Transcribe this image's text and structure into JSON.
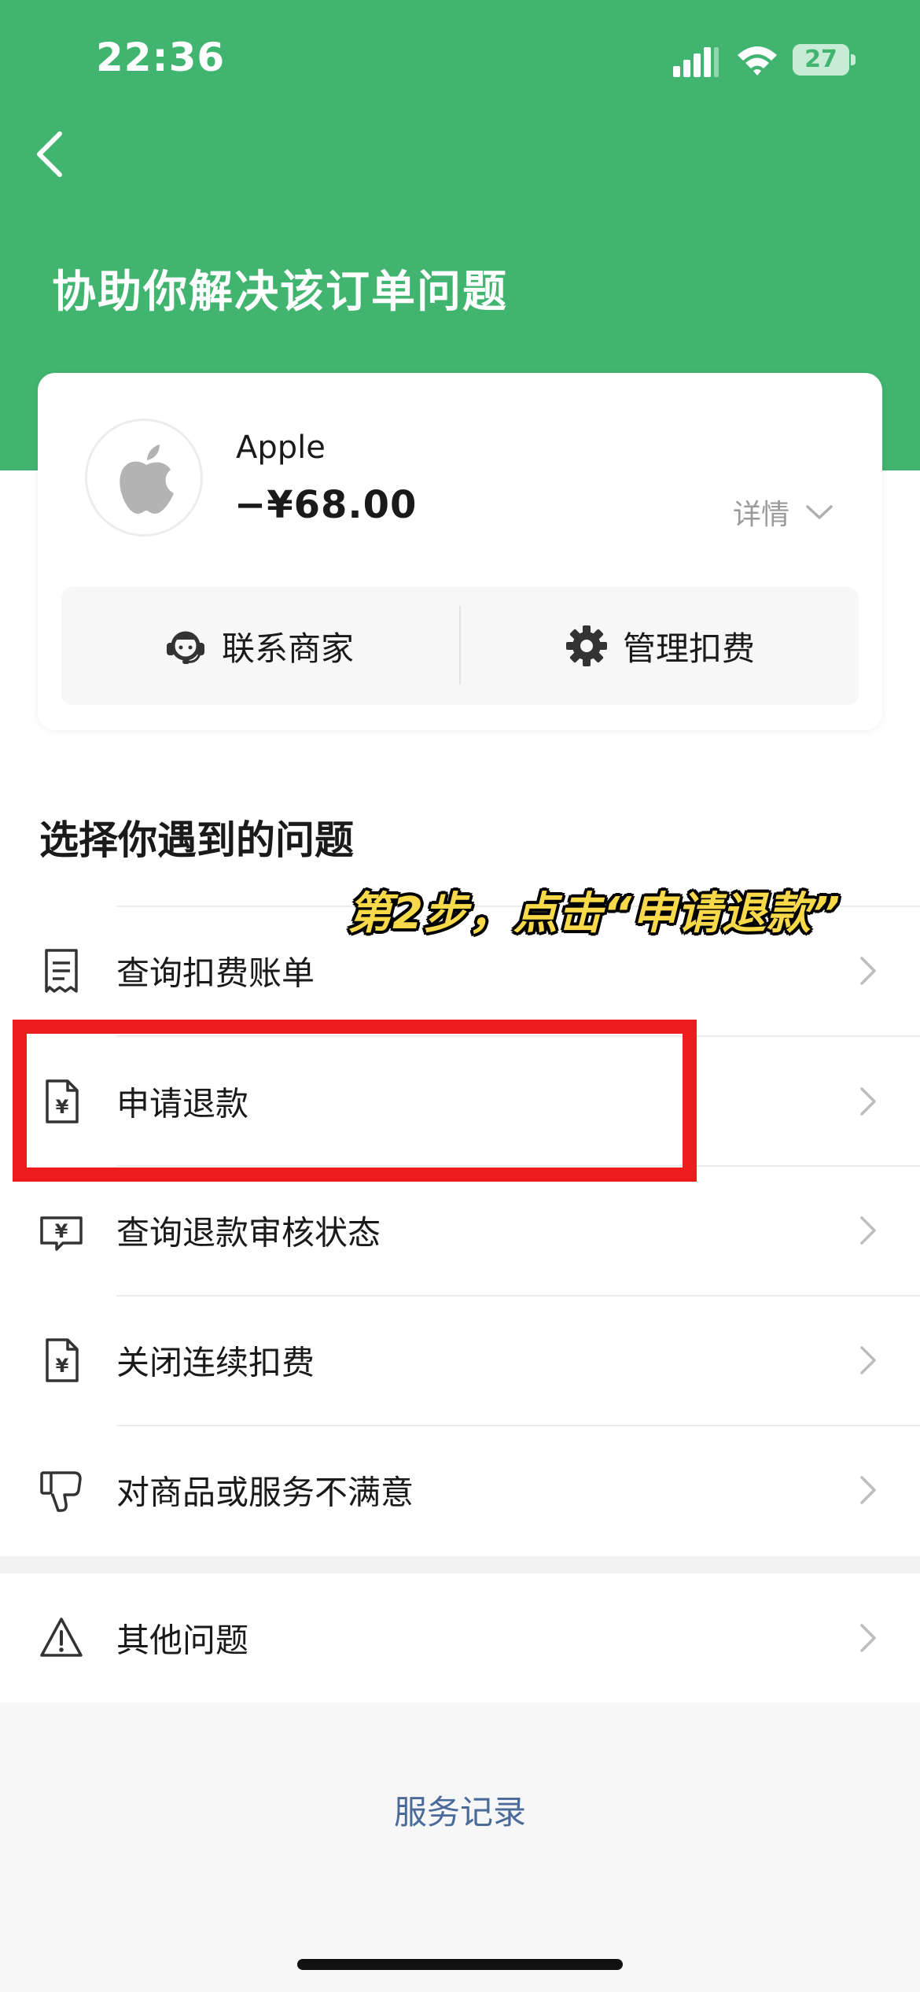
{
  "status_bar": {
    "time": "22:36",
    "battery": "27"
  },
  "header": {
    "title": "协助你解决该订单问题",
    "back_icon": "chevron-left-icon"
  },
  "order_card": {
    "merchant_name": "Apple",
    "amount": "−¥68.00",
    "detail_label": "详情",
    "contact_merchant_label": "联系商家",
    "manage_deduction_label": "管理扣费"
  },
  "section_title": "选择你遇到的问题",
  "menu_items": [
    {
      "label": "查询扣费账单",
      "icon": "receipt-icon"
    },
    {
      "label": "申请退款",
      "icon": "yuan-document-icon"
    },
    {
      "label": "查询退款审核状态",
      "icon": "yuan-ticket-icon"
    },
    {
      "label": "关闭连续扣费",
      "icon": "yuan-document-icon"
    },
    {
      "label": "对商品或服务不满意",
      "icon": "thumbs-down-icon"
    }
  ],
  "other_item": {
    "label": "其他问题",
    "icon": "warning-icon"
  },
  "overlay_caption": "第2步，点击“申请退款”",
  "service_record_label": "服务记录",
  "colors": {
    "brand_green": "#41b46f",
    "highlight_red": "#ee1c1c",
    "caption_yellow": "#f7d94a",
    "link_blue": "#4a6a9a"
  }
}
